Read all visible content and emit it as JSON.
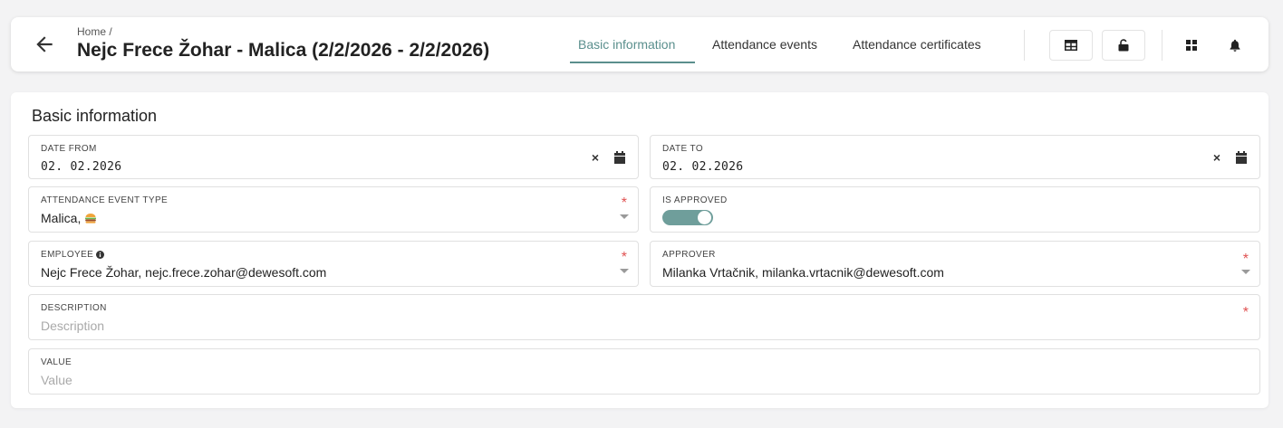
{
  "header": {
    "breadcrumb": "Home /",
    "title": "Nejc Frece Žohar - Malica (2/2/2026 - 2/2/2026)",
    "tabs": [
      {
        "label": "Basic information",
        "active": true
      },
      {
        "label": "Attendance events",
        "active": false
      },
      {
        "label": "Attendance certificates",
        "active": false
      }
    ],
    "icons": [
      "back-arrow-icon",
      "table-icon",
      "unlock-icon",
      "grid-icon",
      "bell-icon"
    ]
  },
  "card": {
    "title": "Basic information"
  },
  "fields": {
    "date_from": {
      "label": "DATE FROM",
      "value": "02. 02.2026"
    },
    "date_to": {
      "label": "DATE TO",
      "value": "02. 02.2026"
    },
    "event_type": {
      "label": "ATTENDANCE EVENT TYPE",
      "value": "Malica,",
      "required": "*"
    },
    "is_approved": {
      "label": "IS APPROVED",
      "value": true
    },
    "employee": {
      "label": "EMPLOYEE",
      "value": "Nejc Frece Žohar, nejc.frece.zohar@dewesoft.com",
      "required": "*"
    },
    "approver": {
      "label": "APPROVER",
      "value": "Milanka Vrtačnik, milanka.vrtacnik@dewesoft.com",
      "required": "*"
    },
    "description": {
      "label": "DESCRIPTION",
      "placeholder": "Description",
      "required": "*"
    },
    "value": {
      "label": "VALUE",
      "placeholder": "Value"
    }
  },
  "colors": {
    "accent": "#5a8f8d",
    "toggle_on": "#6f9e9b",
    "required": "#e05252"
  }
}
